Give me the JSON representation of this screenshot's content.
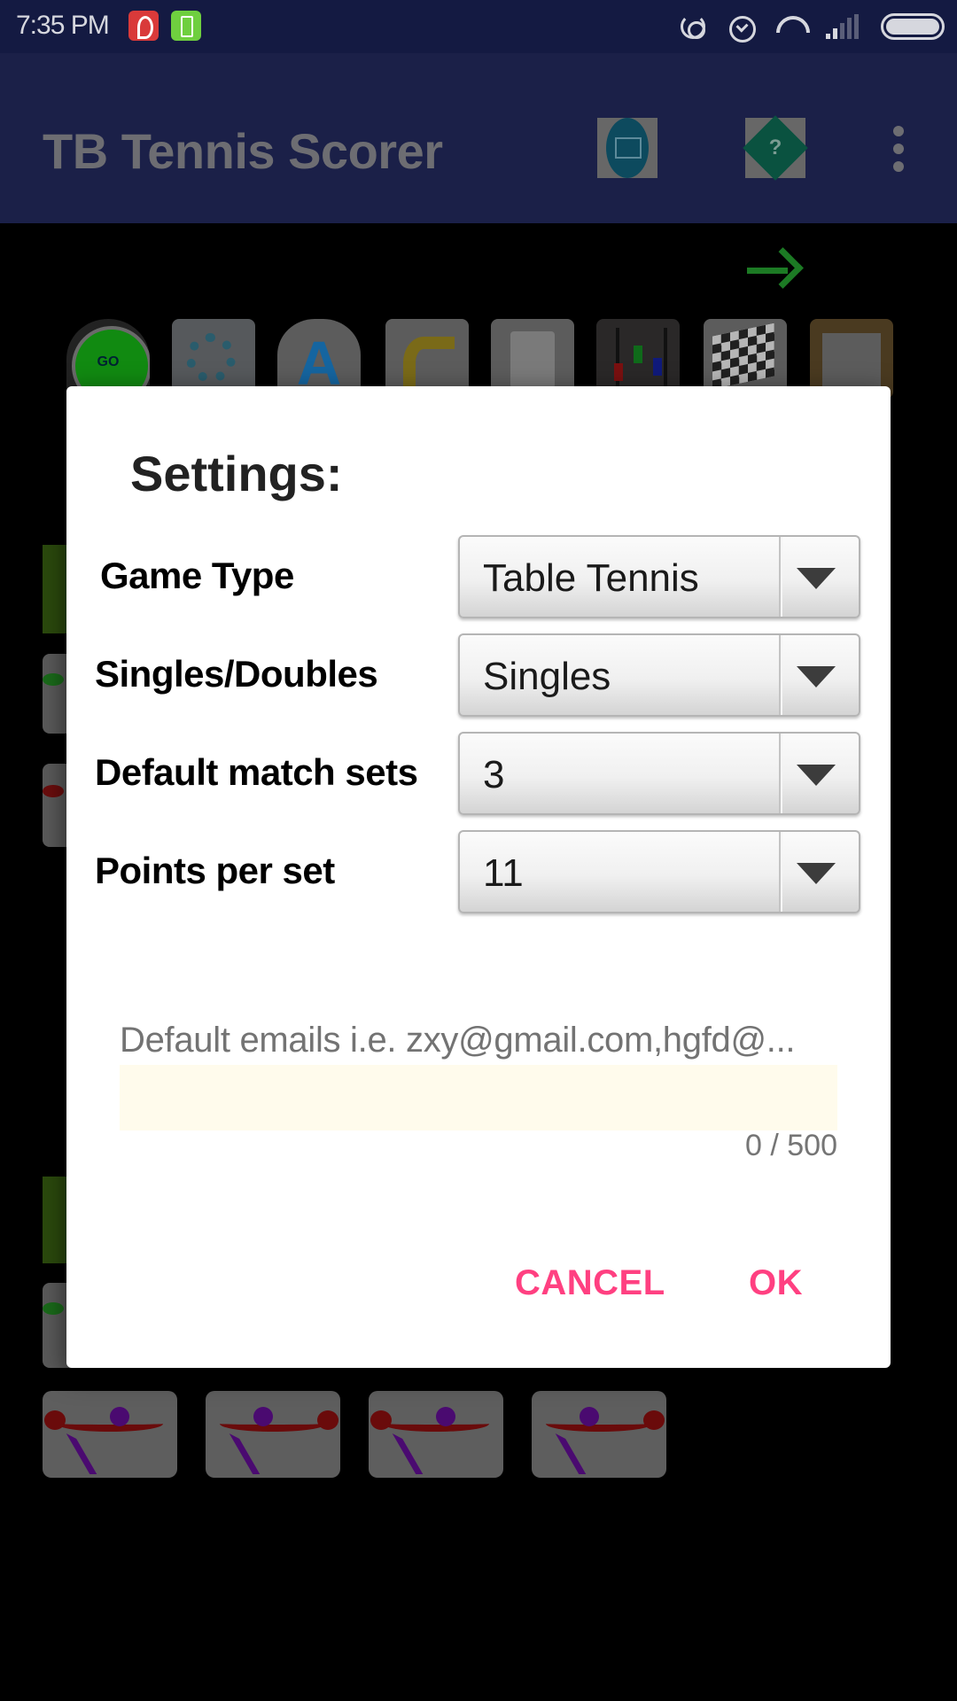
{
  "status_bar": {
    "time": "7:35 PM",
    "left_icons": [
      "app-notification-icon",
      "battery-saver-icon"
    ],
    "right_icons": [
      "sync-icon",
      "alarm-icon",
      "wifi-icon",
      "signal-icon",
      "battery-icon"
    ]
  },
  "app_bar": {
    "title": "TB Tennis Scorer",
    "actions": [
      {
        "name": "email-icon"
      },
      {
        "name": "help-icon",
        "glyph": "?"
      },
      {
        "name": "more-options-icon"
      }
    ]
  },
  "background": {
    "toolbar_icons": [
      "go-icon",
      "settings-gears-icon",
      "font-icon",
      "undo-icon",
      "trash-icon",
      "mixer-icon",
      "checkered-flag-icon",
      "clipboard-icon"
    ],
    "go_label": "GO",
    "font_glyph": "A",
    "next_icon": "arrow-right-icon"
  },
  "dialog": {
    "title": "Settings:",
    "settings": [
      {
        "label": "Game Type",
        "value": "Table Tennis"
      },
      {
        "label": "Singles/Doubles",
        "value": "Singles"
      },
      {
        "label": "Default match sets",
        "value": "3"
      },
      {
        "label": "Points per set",
        "value": "11"
      }
    ],
    "email_field": {
      "placeholder": "Default emails i.e. zxy@gmail.com,hgfd@...",
      "value": "",
      "counter": "0 / 500"
    },
    "buttons": {
      "cancel": "CANCEL",
      "ok": "OK"
    },
    "accent_color": "#ff4081"
  }
}
